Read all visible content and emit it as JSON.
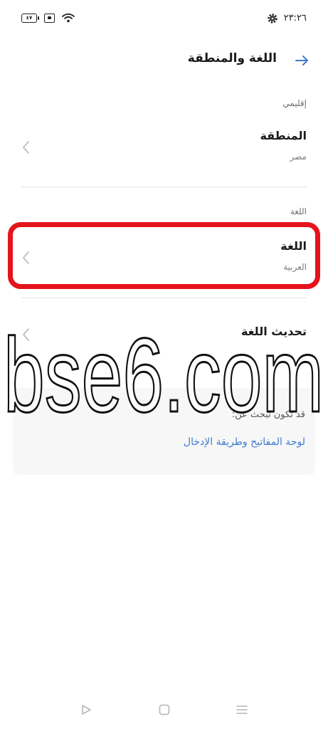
{
  "status": {
    "time": "٢٣:٢٦",
    "battery_level": "٤٧",
    "icons": [
      "battery-icon",
      "sim-icon",
      "wifi-icon",
      "settings-gear-icon"
    ]
  },
  "header": {
    "title": "اللغة والمنطقة",
    "back_icon": "back-arrow-icon"
  },
  "sections": {
    "regional": {
      "label": "إقليمي",
      "item": {
        "title": "المنطقة",
        "value": "مصر"
      }
    },
    "language": {
      "label": "اللغة",
      "item": {
        "title": "اللغة",
        "value": "العربية"
      },
      "update": {
        "title": "تحديث اللغة"
      }
    }
  },
  "suggest": {
    "label": "قد تكون تبحث عن:",
    "link": "لوحة المفاتيح وطريقة الإدخال"
  },
  "watermark": {
    "text": "bse6.com"
  },
  "colors": {
    "accent": "#3d7bd0",
    "highlight": "#e5141c"
  },
  "nav": {
    "icons": [
      "nav-back-icon",
      "nav-home-icon",
      "nav-menu-icon"
    ]
  }
}
